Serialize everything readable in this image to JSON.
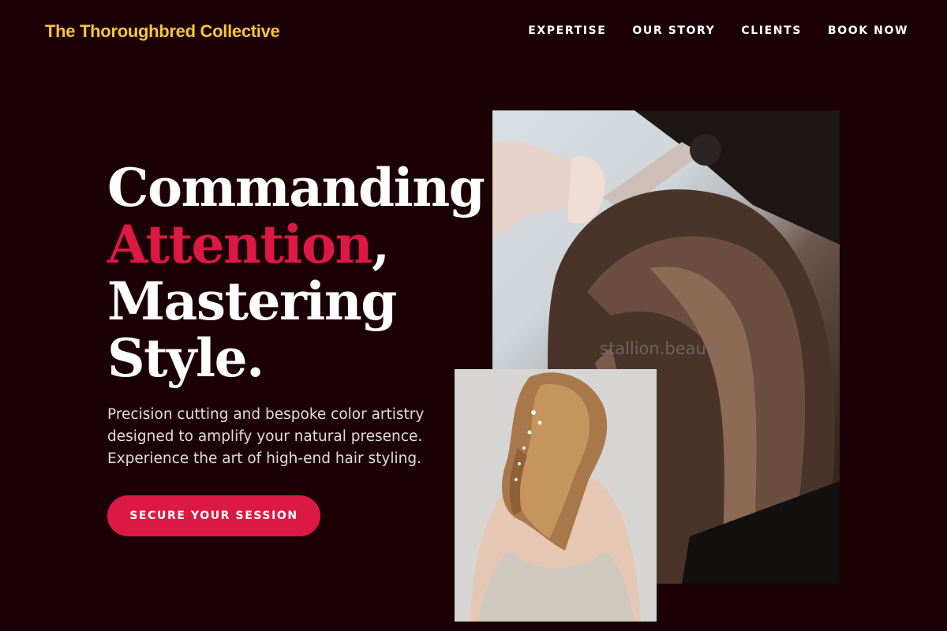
{
  "header": {
    "brand": "The Thoroughbred Collective",
    "nav": [
      {
        "label": "EXPERTISE"
      },
      {
        "label": "OUR STORY"
      },
      {
        "label": "CLIENTS"
      },
      {
        "label": "BOOK NOW"
      }
    ]
  },
  "hero": {
    "headline_line1": "Commanding",
    "headline_accent": "Attention",
    "headline_comma": ",",
    "headline_line3": "Mastering",
    "headline_line4": "Style.",
    "lead": "Precision cutting and bespoke color artistry designed to amplify your natural presence. Experience the art of high-end hair styling.",
    "cta_label": "SECURE YOUR SESSION"
  },
  "media": {
    "watermark": "stallion.beauty",
    "photo_main_icon": "hair-curling-photo",
    "photo_second_icon": "bridal-hairstyle-photo"
  },
  "colors": {
    "background": "#1b0005",
    "brand": "#f6c63a",
    "accent": "#dc1942",
    "text": "#ffffff"
  }
}
